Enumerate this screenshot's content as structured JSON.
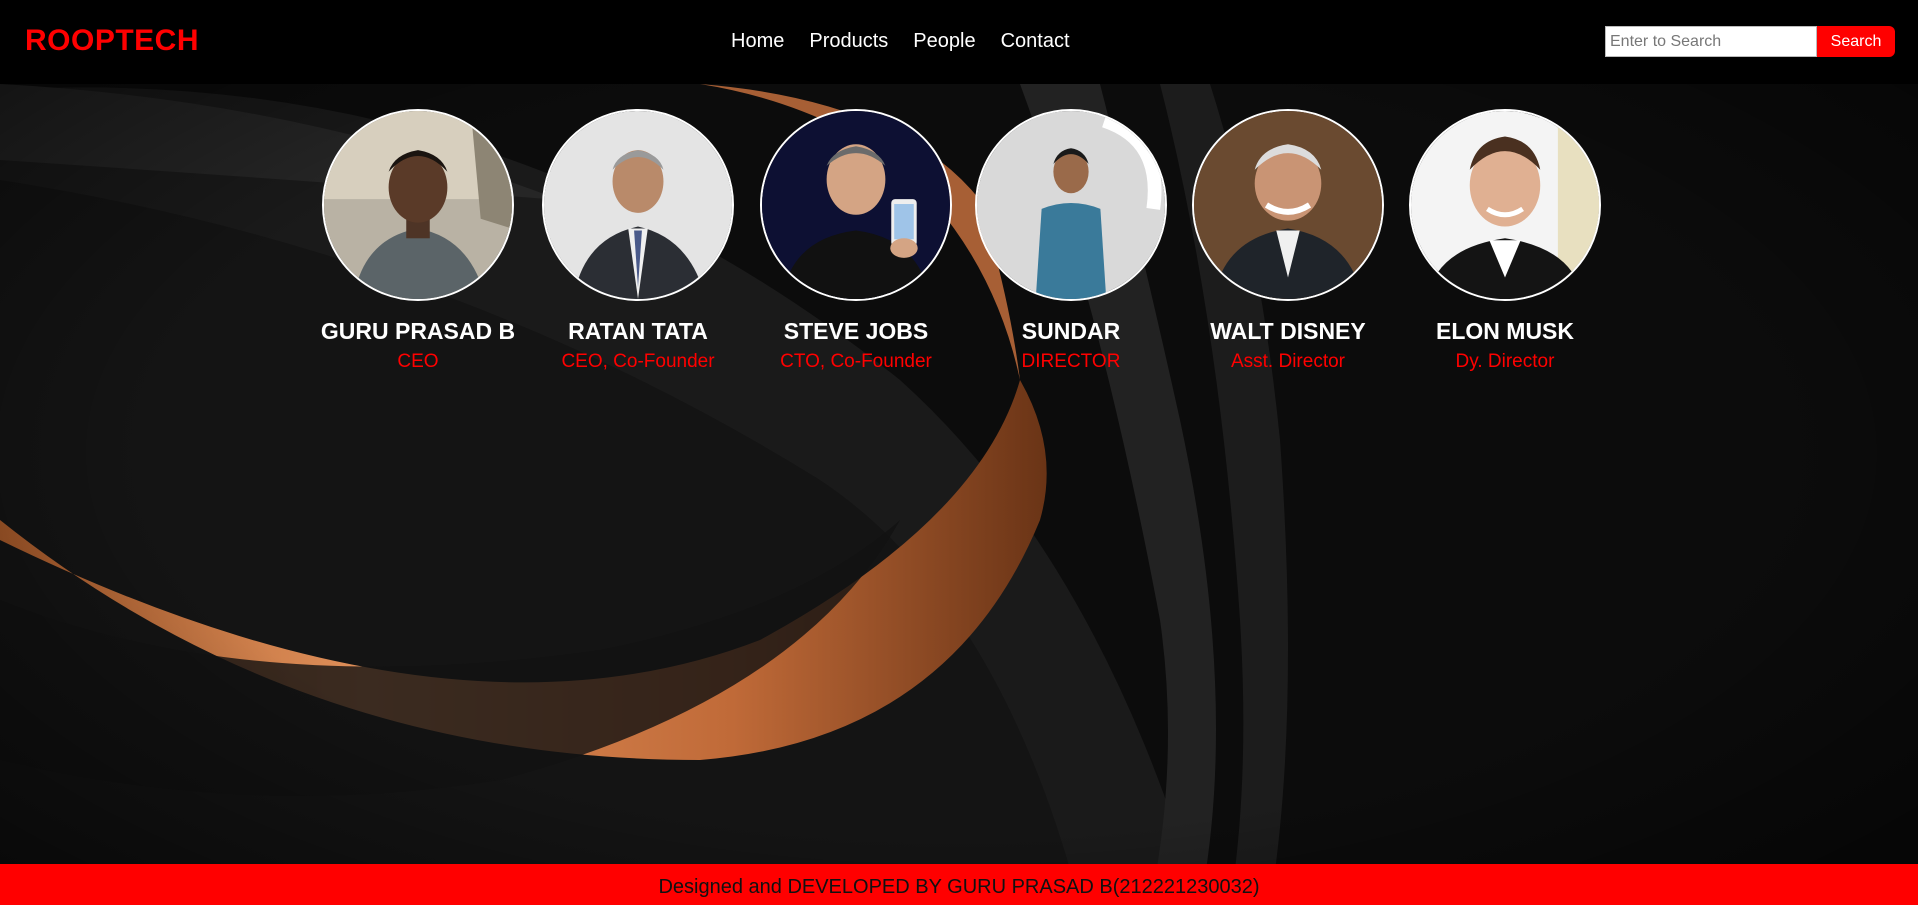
{
  "brand": {
    "name": "ROOPTECH"
  },
  "nav": {
    "items": [
      {
        "label": "Home"
      },
      {
        "label": "Products"
      },
      {
        "label": "People"
      },
      {
        "label": "Contact"
      }
    ]
  },
  "search": {
    "placeholder": "Enter to Search",
    "value": "",
    "button_label": "Search"
  },
  "people": [
    {
      "name": "GURU PRASAD B",
      "role": "CEO"
    },
    {
      "name": "RATAN TATA",
      "role": "CEO, Co-Founder"
    },
    {
      "name": "STEVE JOBS",
      "role": "CTO, Co-Founder"
    },
    {
      "name": "SUNDAR",
      "role": "DIRECTOR"
    },
    {
      "name": "WALT DISNEY",
      "role": "Asst. Director"
    },
    {
      "name": "ELON MUSK",
      "role": "Dy. Director"
    }
  ],
  "footer": {
    "text": "Designed and DEVELOPED BY GURU PRASAD B(212221230032)"
  },
  "colors": {
    "accent": "#ff0000",
    "background": "#0a0a0a",
    "text": "#ffffff",
    "copper": "#c0703c"
  }
}
